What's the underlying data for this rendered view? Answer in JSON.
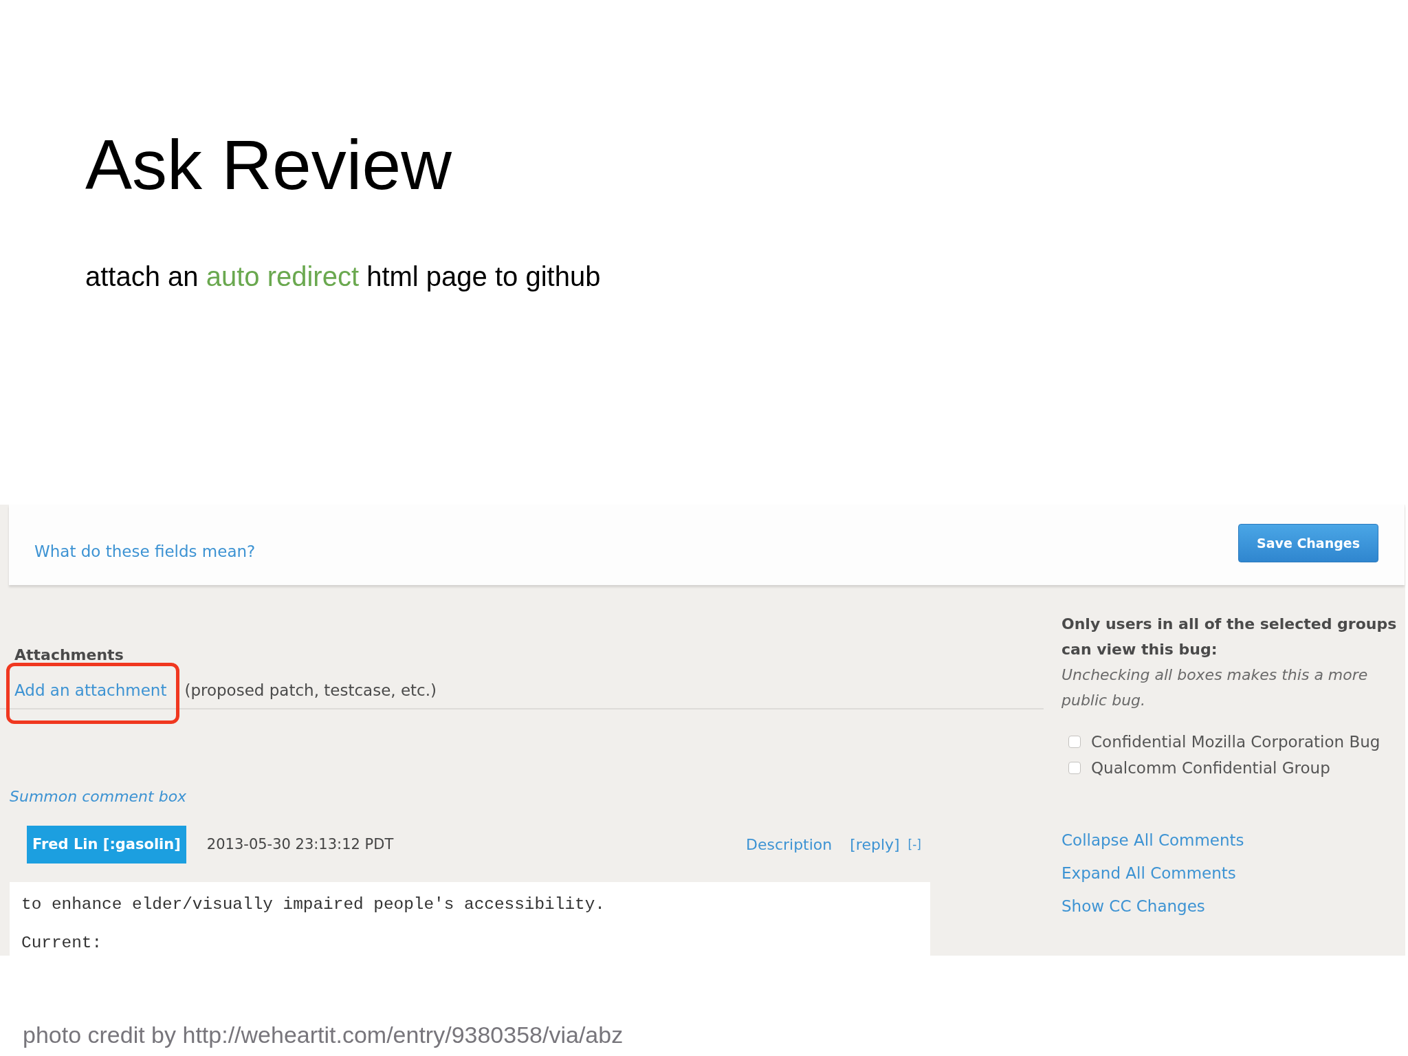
{
  "slide": {
    "title": "Ask Review",
    "subtitle": [
      {
        "text": "attach an ",
        "kind": "plain"
      },
      {
        "text": "auto redirect",
        "kind": "accent"
      },
      {
        "text": " html page to github",
        "kind": "plain"
      }
    ]
  },
  "screenshot": {
    "help_link": "What do these fields mean?",
    "save_button": "Save Changes",
    "attachments": {
      "heading": "Attachments",
      "add_link": "Add an attachment",
      "add_link_highlighted": true,
      "hint": "(proposed patch, testcase, etc.)"
    },
    "groups": {
      "heading": "Only users in all of the selected groups can view this bug:",
      "note": "Unchecking all boxes makes this a more public bug.",
      "options": [
        {
          "label": "Confidential Mozilla Corporation Bug",
          "checked": false
        },
        {
          "label": "Qualcomm Confidential Group",
          "checked": false
        }
      ]
    },
    "summon_link": "Summon comment box",
    "comment": {
      "author": "Fred Lin [:gasolin]",
      "time": "2013-05-30 23:13:12 PDT",
      "links": [
        "Description",
        "[reply]"
      ],
      "collapse_toggle": "[-]",
      "lines": [
        "to enhance elder/visually impaired people's accessibility.",
        "Current:"
      ]
    },
    "comment_actions": [
      "Collapse All Comments",
      "Expand All Comments",
      "Show CC Changes"
    ]
  },
  "photo_credit": "photo credit by http://weheartit.com/entry/9380358/via/abz"
}
